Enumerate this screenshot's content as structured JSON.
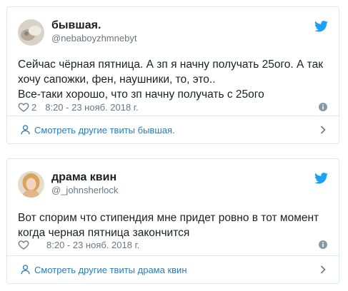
{
  "tweets": [
    {
      "name": "бывшая.",
      "handle": "@nebaboyzhmnebyt",
      "text_lines": [
        "Сейчас чёрная пятница. А зп я начну получать 25ого. А так",
        "хочу сапожки, фен, наушники, то, это..",
        "Все-таки хорошо, что зп начну получать с 25ого"
      ],
      "like_count": "2",
      "timestamp": "8:20 - 23 нояб. 2018 г.",
      "more_link": "Смотреть другие твиты бывшая."
    },
    {
      "name": "драма квин",
      "handle": "@_johnsherlock",
      "text_lines": [
        "Вот спорим что стипендия мне придет ровно в тот момент",
        "когда черная пятница закончится"
      ],
      "like_count": "",
      "timestamp": "8:20 - 23 нояб. 2018 г.",
      "more_link": "Смотреть другие твиты драма квин"
    }
  ],
  "colors": {
    "twitter_blue": "#1da1f2",
    "link_blue": "#2b7bb9",
    "meta_gray": "#697882",
    "border": "#e1e8ed"
  },
  "icons": [
    "twitter-bird-icon",
    "heart-icon",
    "info-icon",
    "person-icon",
    "chevron-right-icon"
  ]
}
